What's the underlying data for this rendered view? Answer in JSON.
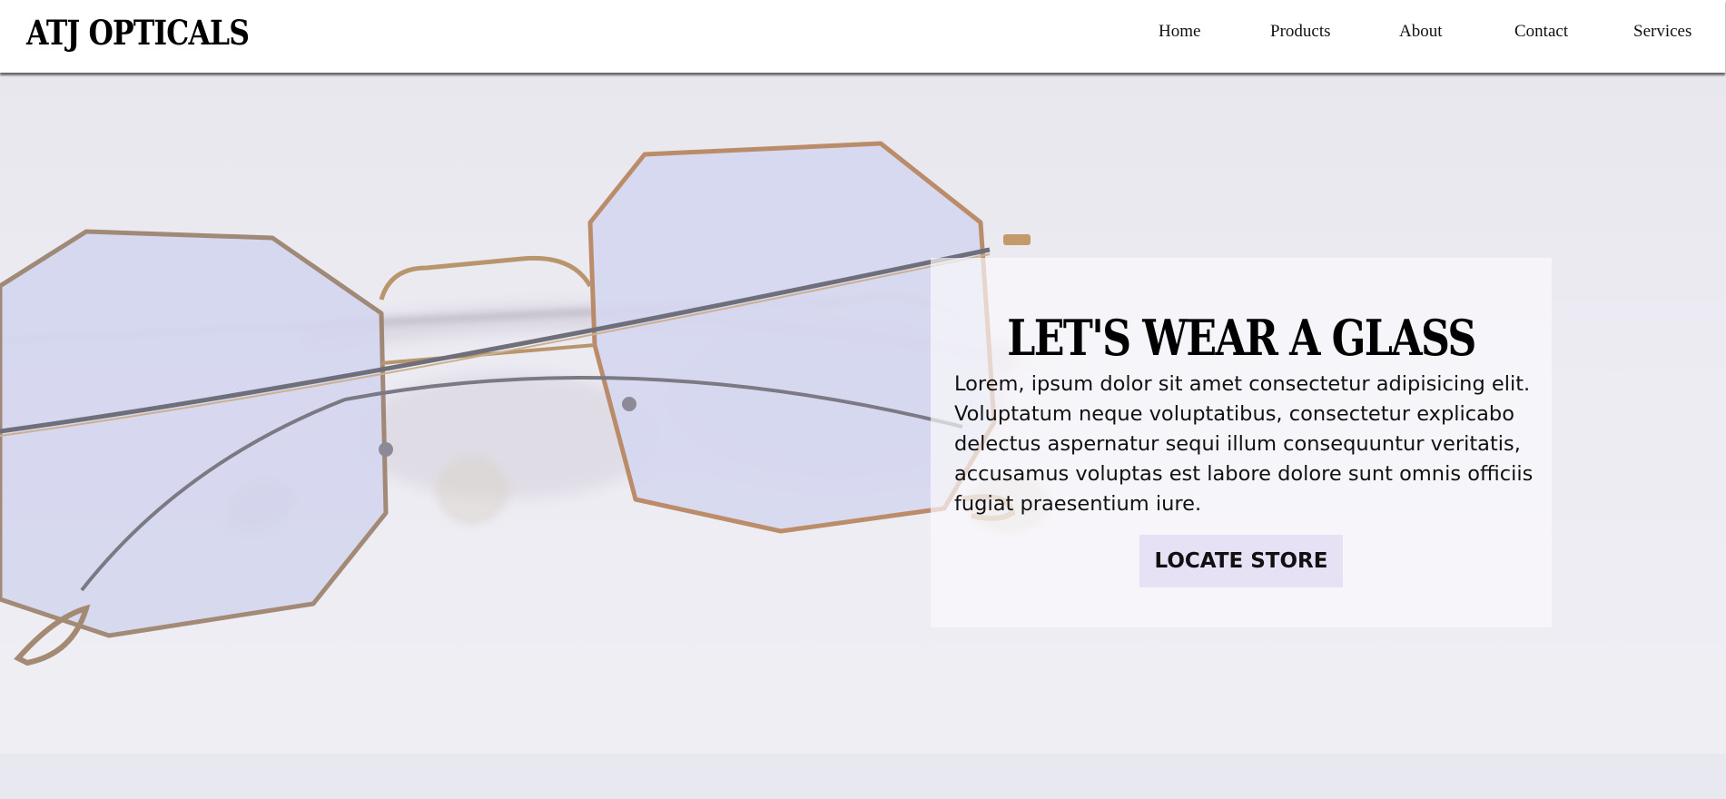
{
  "header": {
    "logo": "ATJ OPTICALS",
    "nav": [
      "Home",
      "Products",
      "About",
      "Contact",
      "Services"
    ]
  },
  "hero": {
    "title": "LET'S WEAR A GLASS",
    "description": "Lorem, ipsum dolor sit amet consectetur adipisicing elit. Voluptatum neque voluptatibus, consectetur explicabo delectus aspernatur sequi illum consequuntur veritatis, accusamus voluptas est labore dolore sunt omnis officiis fugiat praesentium iure.",
    "cta_label": "LOCATE STORE"
  },
  "colors": {
    "header_bg": "#ffffff",
    "hero_bg": "#ecebf2",
    "button_bg": "#e6e1f5",
    "lens_tint": "#d3d6f0",
    "frame_gold": "#b68a5a"
  }
}
